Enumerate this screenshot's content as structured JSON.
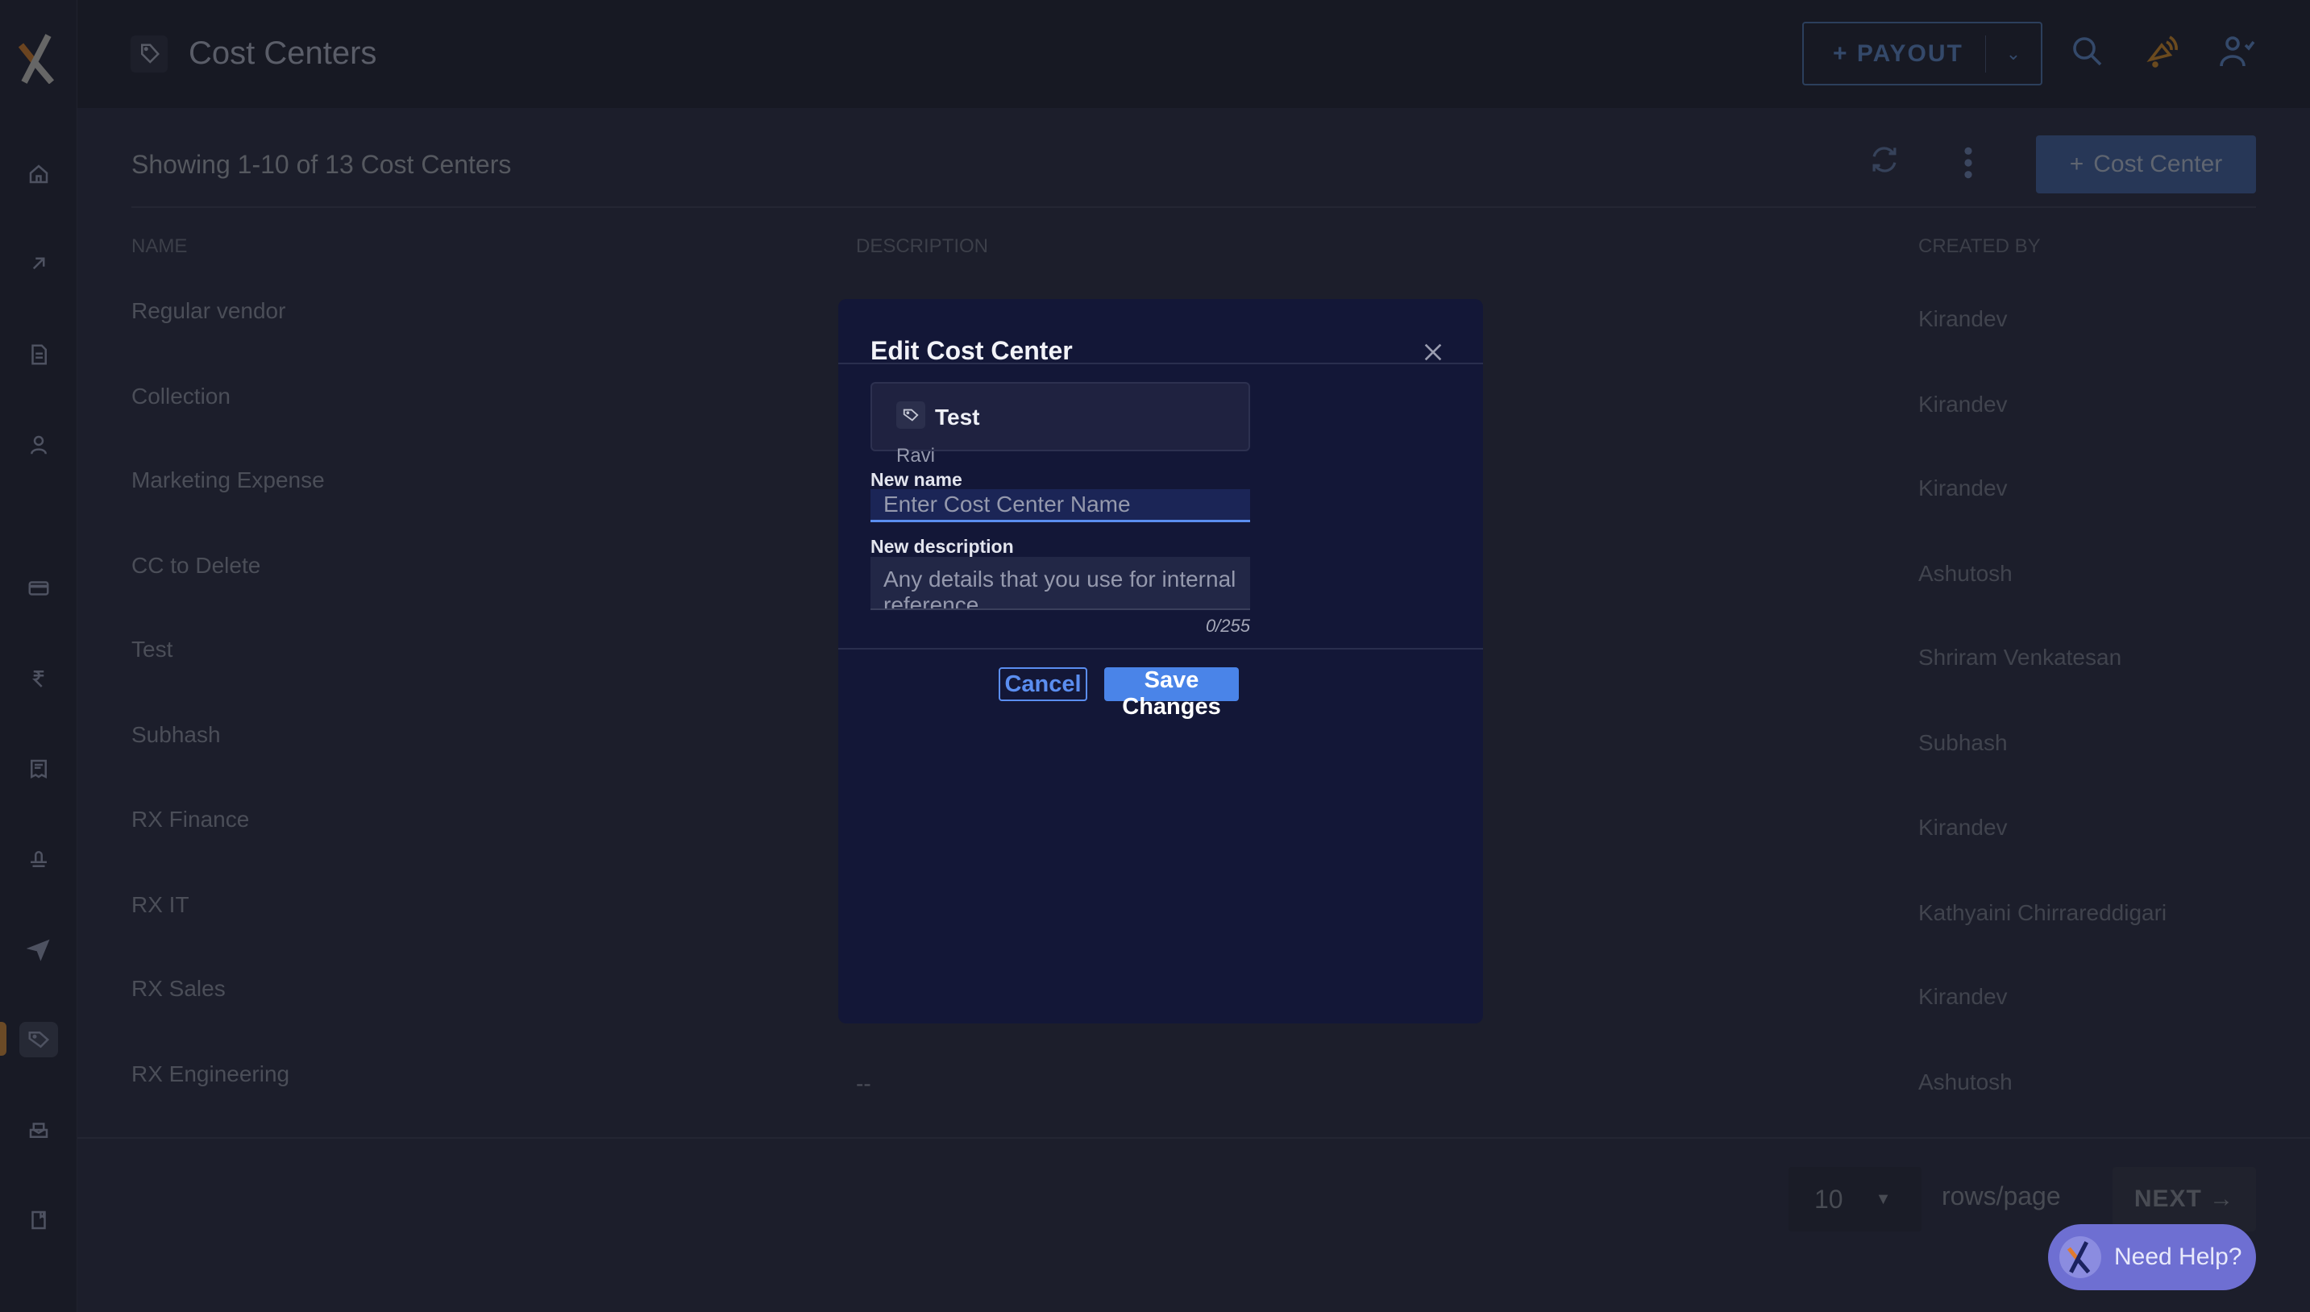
{
  "header": {
    "title": "Cost Centers",
    "payout_label": "+ PAYOUT",
    "title_icon": "tag-icon"
  },
  "content": {
    "showing": "Showing 1-10 of 13 Cost Centers",
    "add_button": "Cost Center"
  },
  "table": {
    "columns": [
      "NAME",
      "DESCRIPTION",
      "CREATED BY"
    ],
    "rows": [
      {
        "name": "Regular vendor",
        "description": "",
        "created_by": "Kirandev"
      },
      {
        "name": "Collection",
        "description": "",
        "created_by": "Kirandev"
      },
      {
        "name": "Marketing Expense",
        "description": "",
        "created_by": "Kirandev"
      },
      {
        "name": "CC to Delete",
        "description": "",
        "created_by": "Ashutosh"
      },
      {
        "name": "Test",
        "description": "",
        "created_by": "Shriram Venkatesan"
      },
      {
        "name": "Subhash",
        "description": "",
        "created_by": "Subhash"
      },
      {
        "name": "RX Finance",
        "description": "",
        "created_by": "Kirandev"
      },
      {
        "name": "RX IT",
        "description": "",
        "created_by": "Kathyaini Chirrareddigari"
      },
      {
        "name": "RX Sales",
        "description": "",
        "created_by": "Kirandev"
      },
      {
        "name": "RX Engineering",
        "description": "--",
        "created_by": "Ashutosh"
      }
    ]
  },
  "pagination": {
    "rows_per_page": "10",
    "rows_label": "rows/page",
    "next_label": "NEXT →"
  },
  "help": {
    "label": "Need Help?"
  },
  "modal": {
    "title": "Edit Cost Center",
    "card": {
      "name": "Test",
      "subtitle": "Ravi"
    },
    "name_label": "New name",
    "name_value": "",
    "name_placeholder": "Enter Cost Center Name",
    "desc_label": "New description",
    "desc_value": "",
    "desc_placeholder": "Any details that you use for internal reference",
    "counter": "0/255",
    "cancel": "Cancel",
    "save": "Save Changes"
  },
  "colors": {
    "accent": "#4a84e8",
    "modal_bg": "#131737",
    "help": "#6e6fd2",
    "brand_orange": "#e07a2e"
  }
}
